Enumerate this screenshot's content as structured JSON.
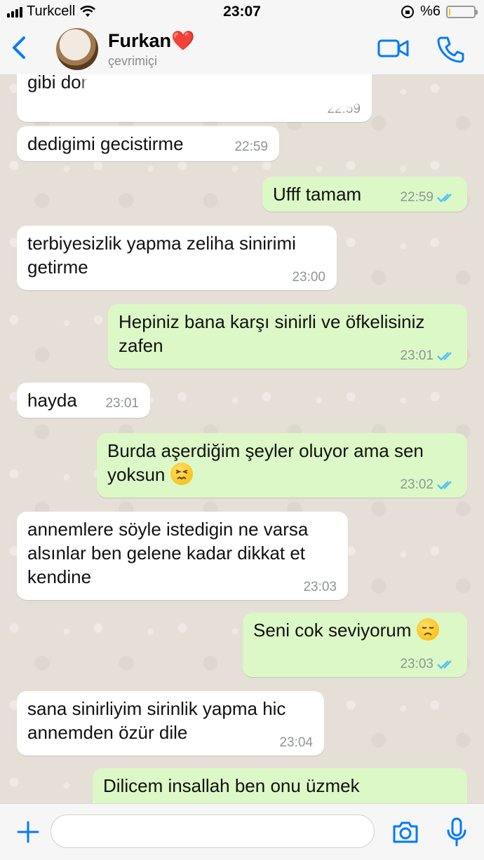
{
  "status_bar": {
    "carrier": "Turkcell",
    "time": "23:07",
    "battery": "%6",
    "battery_level": 0.06
  },
  "header": {
    "contact_name": "Furkan❤️",
    "contact_status": "çevrimiçi"
  },
  "messages": [
    {
      "dir": "in",
      "text": "gibi donerim insallah",
      "time": "22:59"
    },
    {
      "dir": "in",
      "text": "dedigimi gecistirme",
      "time": "22:59"
    },
    {
      "dir": "out",
      "text": "Ufff tamam",
      "time": "22:59"
    },
    {
      "dir": "in",
      "text": "terbiyesizlik yapma zeliha sinirimi getirme",
      "time": "23:00"
    },
    {
      "dir": "out",
      "text": "Hepiniz bana karşı sinirli ve öfkelisiniz zafen",
      "time": "23:01"
    },
    {
      "dir": "in",
      "text": "hayda",
      "time": "23:01"
    },
    {
      "dir": "out",
      "text": "Burda aşerdiğim şeyler oluyor ama sen yoksun",
      "emoji": "persevering-face",
      "time": "23:02"
    },
    {
      "dir": "in",
      "text": "annemlere söyle istedigin ne varsa alsınlar ben gelene kadar dikkat et kendine",
      "time": "23:03"
    },
    {
      "dir": "out",
      "text": "Seni cok seviyorum",
      "emoji": "disappointed-face",
      "time": "23:03"
    },
    {
      "dir": "in",
      "text": "sana sinirliyim sirinlik yapma hic annemden özür dile",
      "time": "23:04"
    },
    {
      "dir": "out",
      "text": "Dilicem insallah ben onu üzmek",
      "time": ""
    }
  ],
  "composer": {
    "placeholder": ""
  },
  "colors": {
    "accent": "#007aff",
    "incoming_bubble": "#ffffff",
    "outgoing_bubble": "#dcf8c6",
    "read_tick": "#4fc3f7"
  },
  "icons": [
    "back-chevron-icon",
    "video-call-icon",
    "phone-icon",
    "plus-icon",
    "camera-icon",
    "microphone-icon",
    "double-check-icon"
  ]
}
